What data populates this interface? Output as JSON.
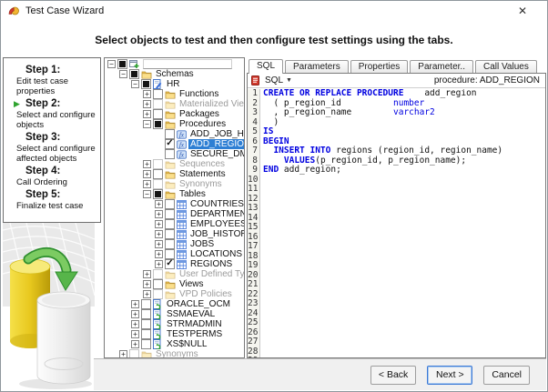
{
  "window": {
    "title": "Test Case Wizard",
    "close_glyph": "✕"
  },
  "header": {
    "instruction": "Select objects to test and then configure test settings using the tabs."
  },
  "steps": [
    {
      "title": "Step 1:",
      "desc": "Edit test case properties",
      "active": false
    },
    {
      "title": "Step 2:",
      "desc": "Select and configure objects",
      "active": true
    },
    {
      "title": "Step 3:",
      "desc": "Select and configure affected objects",
      "active": false
    },
    {
      "title": "Step 4:",
      "desc": "Call Ordering",
      "active": false
    },
    {
      "title": "Step 5:",
      "desc": "Finalize test case",
      "active": false
    }
  ],
  "tree": {
    "rows": [
      {
        "label": "",
        "level": 0,
        "exp": "-",
        "cb": "filled",
        "icon": "root",
        "disabled": false,
        "selected": false,
        "edit": true
      },
      {
        "label": "Schemas",
        "level": 1,
        "exp": "-",
        "cb": "filled",
        "icon": "folder",
        "disabled": false,
        "selected": false,
        "edit": false
      },
      {
        "label": "HR",
        "level": 2,
        "exp": "-",
        "cb": "filled",
        "icon": "schema_hr",
        "disabled": false,
        "selected": false,
        "edit": false
      },
      {
        "label": "Functions",
        "level": 3,
        "exp": "+",
        "cb": "empty",
        "icon": "folder",
        "disabled": false,
        "selected": false,
        "edit": false
      },
      {
        "label": "Materialized Views",
        "level": 3,
        "exp": "+",
        "cb": "disabled",
        "icon": "folder",
        "disabled": true,
        "selected": false,
        "edit": false
      },
      {
        "label": "Packages",
        "level": 3,
        "exp": "+",
        "cb": "empty",
        "icon": "folder",
        "disabled": false,
        "selected": false,
        "edit": false
      },
      {
        "label": "Procedures",
        "level": 3,
        "exp": "-",
        "cb": "filled",
        "icon": "folder",
        "disabled": false,
        "selected": false,
        "edit": false
      },
      {
        "label": "ADD_JOB_HISTORY",
        "level": 4,
        "exp": "",
        "cb": "empty",
        "icon": "proc",
        "disabled": false,
        "selected": false,
        "edit": false
      },
      {
        "label": "ADD_REGION",
        "level": 4,
        "exp": "",
        "cb": "checked",
        "icon": "proc",
        "disabled": false,
        "selected": true,
        "edit": false
      },
      {
        "label": "SECURE_DML",
        "level": 4,
        "exp": "",
        "cb": "empty",
        "icon": "proc",
        "disabled": false,
        "selected": false,
        "edit": false
      },
      {
        "label": "Sequences",
        "level": 3,
        "exp": "+",
        "cb": "disabled",
        "icon": "folder",
        "disabled": true,
        "selected": false,
        "edit": false
      },
      {
        "label": "Statements",
        "level": 3,
        "exp": "+",
        "cb": "empty",
        "icon": "folder",
        "disabled": false,
        "selected": false,
        "edit": false
      },
      {
        "label": "Synonyms",
        "level": 3,
        "exp": "+",
        "cb": "disabled",
        "icon": "folder",
        "disabled": true,
        "selected": false,
        "edit": false
      },
      {
        "label": "Tables",
        "level": 3,
        "exp": "-",
        "cb": "filled",
        "icon": "folder",
        "disabled": false,
        "selected": false,
        "edit": false
      },
      {
        "label": "COUNTRIES",
        "level": 4,
        "exp": "+",
        "cb": "empty",
        "icon": "table",
        "disabled": false,
        "selected": false,
        "edit": false
      },
      {
        "label": "DEPARTMENTS",
        "level": 4,
        "exp": "+",
        "cb": "empty",
        "icon": "table",
        "disabled": false,
        "selected": false,
        "edit": false
      },
      {
        "label": "EMPLOYEES",
        "level": 4,
        "exp": "+",
        "cb": "empty",
        "icon": "table",
        "disabled": false,
        "selected": false,
        "edit": false
      },
      {
        "label": "JOB_HISTORY",
        "level": 4,
        "exp": "+",
        "cb": "empty",
        "icon": "table",
        "disabled": false,
        "selected": false,
        "edit": false
      },
      {
        "label": "JOBS",
        "level": 4,
        "exp": "+",
        "cb": "empty",
        "icon": "table",
        "disabled": false,
        "selected": false,
        "edit": false
      },
      {
        "label": "LOCATIONS",
        "level": 4,
        "exp": "+",
        "cb": "empty",
        "icon": "table",
        "disabled": false,
        "selected": false,
        "edit": false
      },
      {
        "label": "REGIONS",
        "level": 4,
        "exp": "+",
        "cb": "checked",
        "icon": "table",
        "disabled": false,
        "selected": false,
        "edit": false
      },
      {
        "label": "User Defined Types",
        "level": 3,
        "exp": "+",
        "cb": "disabled",
        "icon": "folder",
        "disabled": true,
        "selected": false,
        "edit": false
      },
      {
        "label": "Views",
        "level": 3,
        "exp": "+",
        "cb": "empty",
        "icon": "folder",
        "disabled": false,
        "selected": false,
        "edit": false
      },
      {
        "label": "VPD Policies",
        "level": 3,
        "exp": "+",
        "cb": "disabled",
        "icon": "folder",
        "disabled": true,
        "selected": false,
        "edit": false
      },
      {
        "label": "ORACLE_OCM",
        "level": 2,
        "exp": "+",
        "cb": "empty",
        "icon": "schema",
        "disabled": false,
        "selected": false,
        "edit": false
      },
      {
        "label": "SSMAEVAL",
        "level": 2,
        "exp": "+",
        "cb": "empty",
        "icon": "schema",
        "disabled": false,
        "selected": false,
        "edit": false
      },
      {
        "label": "STRMADMIN",
        "level": 2,
        "exp": "+",
        "cb": "empty",
        "icon": "schema",
        "disabled": false,
        "selected": false,
        "edit": false
      },
      {
        "label": "TESTPERMS",
        "level": 2,
        "exp": "+",
        "cb": "empty",
        "icon": "schema",
        "disabled": false,
        "selected": false,
        "edit": false
      },
      {
        "label": "XS$NULL",
        "level": 2,
        "exp": "+",
        "cb": "empty",
        "icon": "schema",
        "disabled": false,
        "selected": false,
        "edit": false
      },
      {
        "label": "Synonyms",
        "level": 1,
        "exp": "+",
        "cb": "disabled",
        "icon": "folder",
        "disabled": true,
        "selected": false,
        "edit": false
      }
    ]
  },
  "sql_panel": {
    "tabs": [
      {
        "label": "SQL",
        "active": true
      },
      {
        "label": "Parameters",
        "active": false
      },
      {
        "label": "Properties",
        "active": false
      },
      {
        "label": "Parameter..",
        "active": false
      },
      {
        "label": "Call Values",
        "active": false
      }
    ],
    "toolbar": {
      "sql_dropdown": "SQL",
      "dropdown_arrow": "▼",
      "object_label": "procedure: ADD_REGION"
    },
    "editor": {
      "visible_line_numbers": 30,
      "code_lines": [
        {
          "segments": [
            {
              "s": "kw",
              "t": "CREATE OR REPLACE PROCEDURE"
            },
            {
              "s": "p",
              "t": "    add_region"
            }
          ]
        },
        {
          "segments": [
            {
              "s": "p",
              "t": "  ( p_region_id          "
            },
            {
              "s": "ty",
              "t": "number"
            }
          ]
        },
        {
          "segments": [
            {
              "s": "p",
              "t": "  , p_region_name        "
            },
            {
              "s": "ty",
              "t": "varchar2"
            }
          ]
        },
        {
          "segments": [
            {
              "s": "p",
              "t": "  )"
            }
          ]
        },
        {
          "segments": [
            {
              "s": "kw",
              "t": "IS"
            }
          ]
        },
        {
          "segments": [
            {
              "s": "kw",
              "t": "BEGIN"
            }
          ]
        },
        {
          "segments": [
            {
              "s": "p",
              "t": "  "
            },
            {
              "s": "kw",
              "t": "INSERT INTO"
            },
            {
              "s": "p",
              "t": " regions (region_id, region_name)"
            }
          ]
        },
        {
          "segments": [
            {
              "s": "p",
              "t": "    "
            },
            {
              "s": "kw",
              "t": "VALUES"
            },
            {
              "s": "p",
              "t": "(p_region_id, p_region_name);"
            }
          ]
        },
        {
          "segments": [
            {
              "s": "kw",
              "t": "END"
            },
            {
              "s": "p",
              "t": " add_region;"
            }
          ]
        }
      ]
    }
  },
  "footer": {
    "buttons": [
      {
        "label": "< Back",
        "focused": false
      },
      {
        "label": "Next >",
        "focused": true
      },
      {
        "label": "Cancel",
        "focused": false
      }
    ]
  },
  "colors": {
    "selection": "#2e7fd4",
    "keyword": "#0000e0",
    "disabled_text": "#9b9b9b",
    "accent_green": "#2fa32f"
  }
}
